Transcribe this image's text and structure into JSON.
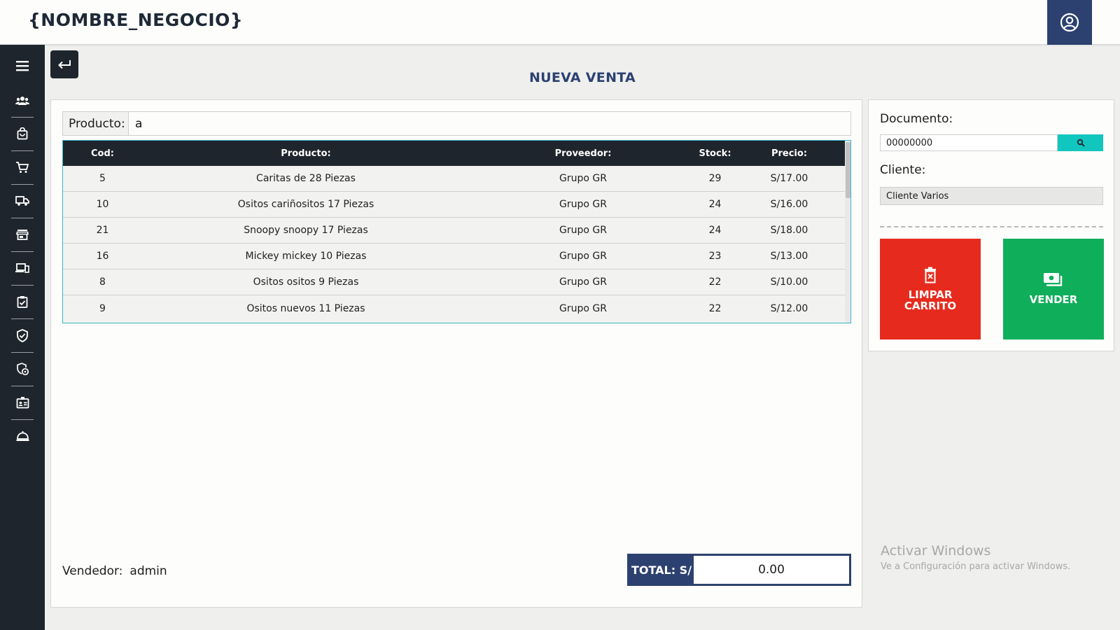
{
  "header": {
    "brand": "{NOMBRE_NEGOCIO}"
  },
  "page": {
    "title": "NUEVA VENTA"
  },
  "search": {
    "label": "Producto:",
    "value": "a"
  },
  "table": {
    "headers": [
      "Cod:",
      "Producto:",
      "Proveedor:",
      "Stock:",
      "Precio:"
    ],
    "rows": [
      [
        "5",
        "Caritas de 28 Piezas",
        "Grupo GR",
        "29",
        "S/17.00"
      ],
      [
        "10",
        "Ositos cariñositos 17 Piezas",
        "Grupo GR",
        "24",
        "S/16.00"
      ],
      [
        "21",
        "Snoopy snoopy 17 Piezas",
        "Grupo GR",
        "24",
        "S/18.00"
      ],
      [
        "16",
        "Mickey mickey 10 Piezas",
        "Grupo GR",
        "23",
        "S/13.00"
      ],
      [
        "8",
        "Ositos ositos 9 Piezas",
        "Grupo GR",
        "22",
        "S/10.00"
      ],
      [
        "9",
        "Ositos nuevos 11 Piezas",
        "Grupo GR",
        "22",
        "S/12.00"
      ]
    ]
  },
  "seller": {
    "label": "Vendedor:",
    "name": "admin"
  },
  "total": {
    "label": "TOTAL: S/",
    "value": "0.00"
  },
  "document": {
    "label": "Documento:",
    "value": "00000000"
  },
  "client": {
    "label": "Cliente:",
    "value": "Cliente Varios"
  },
  "actions": {
    "clear_line1": "LIMPAR",
    "clear_line2": "CARRITO",
    "sell": "VENDER"
  },
  "watermark": {
    "title": "Activar Windows",
    "subtitle": "Ve a Configuración para activar Windows."
  },
  "sidebar_icons": [
    "menu-icon",
    "users-icon",
    "shopping-bag-icon",
    "cart-icon",
    "truck-icon",
    "store-icon",
    "devices-icon",
    "clipboard-check-icon",
    "shield-check-icon",
    "settings-shield-icon",
    "id-badge-icon",
    "bell-icon"
  ],
  "colors": {
    "navy": "#2c4170",
    "dark": "#1f252c",
    "red": "#e62b1e",
    "green": "#0fae5a",
    "teal": "#11c6bf"
  }
}
